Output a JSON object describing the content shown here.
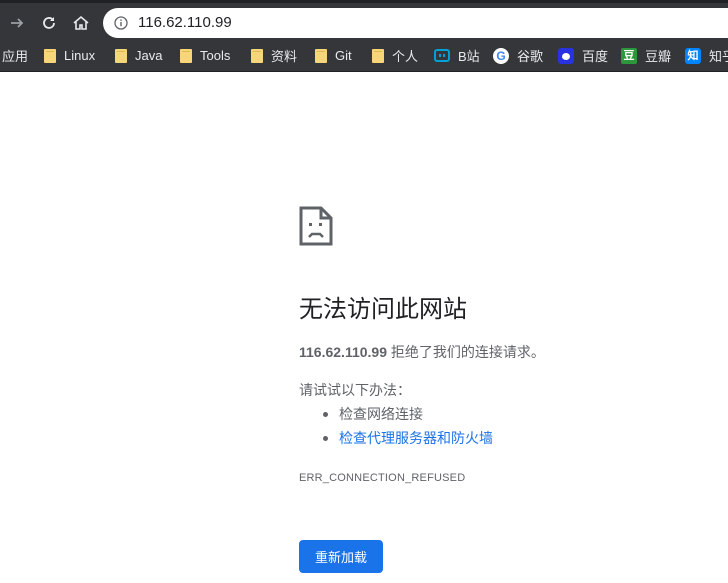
{
  "browser": {
    "url": "116.62.110.99",
    "nav_icons": [
      "forward-icon",
      "reload-icon",
      "home-icon",
      "info-icon"
    ],
    "bookmarks": [
      {
        "label": "应用",
        "icon": "apps-icon"
      },
      {
        "label": "Linux",
        "icon": "folder-icon"
      },
      {
        "label": "Java",
        "icon": "folder-icon"
      },
      {
        "label": "Tools",
        "icon": "folder-icon"
      },
      {
        "label": "资料",
        "icon": "folder-icon"
      },
      {
        "label": "Git",
        "icon": "folder-icon"
      },
      {
        "label": "个人",
        "icon": "folder-icon"
      },
      {
        "label": "B站",
        "icon": "bilibili-icon"
      },
      {
        "label": "谷歌",
        "icon": "google-icon"
      },
      {
        "label": "百度",
        "icon": "baidu-icon"
      },
      {
        "label": "豆瓣",
        "icon": "douban-icon"
      },
      {
        "label": "知乎",
        "icon": "zhihu-icon"
      }
    ],
    "favicon_glyphs": {
      "google": "G",
      "douban": "豆",
      "zhihu": "知"
    }
  },
  "error_page": {
    "icon": "sad-document-icon",
    "headline": "无法访问此网站",
    "host": "116.62.110.99",
    "message": " 拒绝了我们的连接请求。",
    "try_label": "请试试以下办法：",
    "suggestions": [
      "检查网络连接",
      "检查代理服务器和防火墙"
    ],
    "error_code": "ERR_CONNECTION_REFUSED",
    "reload_label": "重新加载"
  },
  "colors": {
    "toolbar_bg": "#35363a",
    "link": "#1a73e8",
    "button_bg": "#1a73e8",
    "text_secondary": "#5f6368"
  }
}
